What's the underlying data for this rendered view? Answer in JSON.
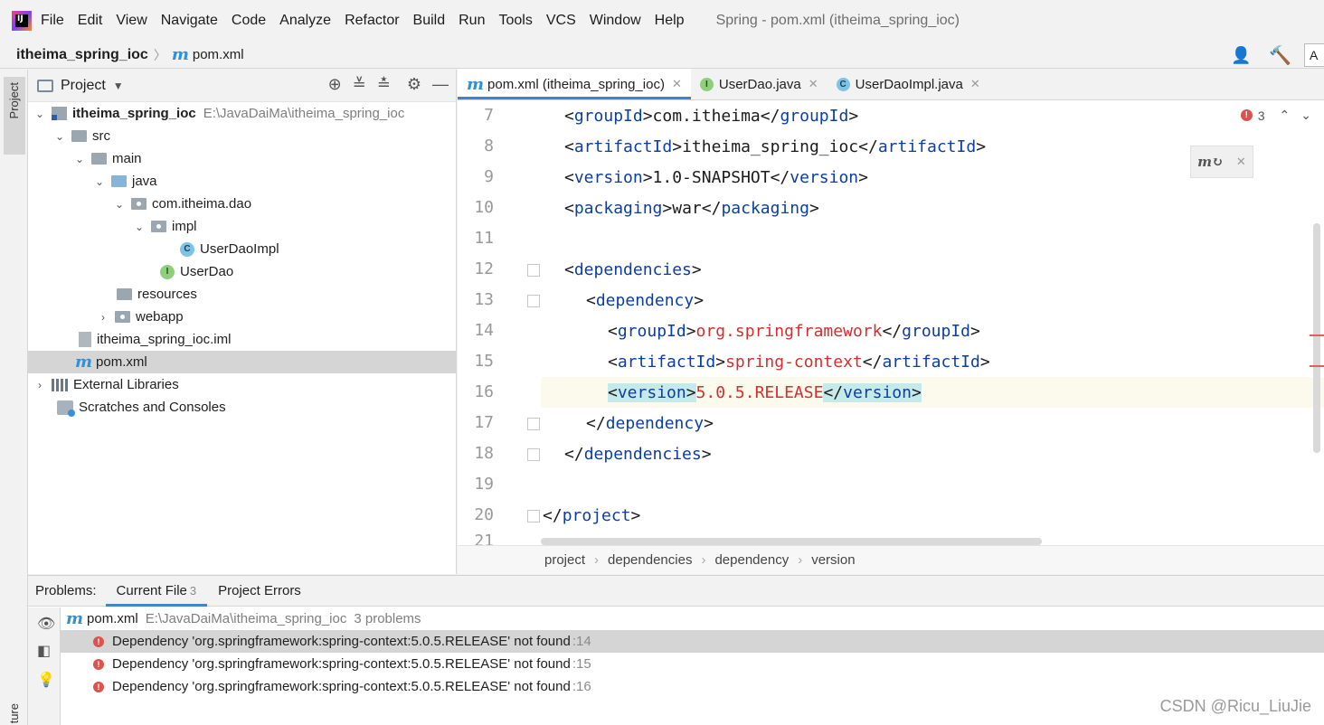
{
  "menubar": {
    "items": [
      "File",
      "Edit",
      "View",
      "Navigate",
      "Code",
      "Analyze",
      "Refactor",
      "Build",
      "Run",
      "Tools",
      "VCS",
      "Window",
      "Help"
    ],
    "window_title": "Spring - pom.xml (itheima_spring_ioc)"
  },
  "navbar": {
    "project": "itheima_spring_ioc",
    "file": "pom.xml",
    "right_button": "A"
  },
  "stripe": {
    "project_tab": "Project",
    "structure_tab": "ture"
  },
  "project_panel": {
    "title": "Project",
    "tree": [
      {
        "label": "itheima_spring_ioc",
        "path": "E:\\JavaDaiMa\\itheima_spring_ioc"
      },
      {
        "label": "src"
      },
      {
        "label": "main"
      },
      {
        "label": "java"
      },
      {
        "label": "com.itheima.dao"
      },
      {
        "label": "impl"
      },
      {
        "label": "UserDaoImpl"
      },
      {
        "label": "UserDao"
      },
      {
        "label": "resources"
      },
      {
        "label": "webapp"
      },
      {
        "label": "itheima_spring_ioc.iml"
      },
      {
        "label": "pom.xml"
      },
      {
        "label": "External Libraries"
      },
      {
        "label": "Scratches and Consoles"
      }
    ]
  },
  "editor": {
    "tabs": [
      {
        "label": "pom.xml (itheima_spring_ioc)",
        "active": true
      },
      {
        "label": "UserDao.java"
      },
      {
        "label": "UserDaoImpl.java"
      }
    ],
    "error_count": "3",
    "line_numbers": [
      "7",
      "8",
      "9",
      "10",
      "11",
      "12",
      "13",
      "14",
      "15",
      "16",
      "17",
      "18",
      "19",
      "20",
      "21"
    ],
    "code": {
      "l7_tag": "groupId",
      "l7_val": "com.itheima",
      "l8_tag": "artifactId",
      "l8_val": "itheima_spring_ioc",
      "l9_tag": "version",
      "l9_val": "1.0-SNAPSHOT",
      "l10_tag": "packaging",
      "l10_val": "war",
      "l12_tag": "dependencies",
      "l13_tag": "dependency",
      "l14_tag": "groupId",
      "l14_val": "org.springframework",
      "l15_tag": "artifactId",
      "l15_val": "spring-context",
      "l16_tag": "version",
      "l16_val": "5.0.5.RELEASE",
      "l17_tag": "dependency",
      "l18_tag": "dependencies",
      "l20_tag": "project"
    },
    "breadcrumb": [
      "project",
      "dependencies",
      "dependency",
      "version"
    ]
  },
  "problems": {
    "label": "Problems:",
    "tabs": [
      {
        "label": "Current File",
        "count": "3",
        "active": true
      },
      {
        "label": "Project Errors"
      }
    ],
    "file": "pom.xml",
    "file_path": "E:\\JavaDaiMa\\itheima_spring_ioc",
    "summary": "3 problems",
    "items": [
      {
        "message": "Dependency 'org.springframework:spring-context:5.0.5.RELEASE' not found",
        "line": ":14"
      },
      {
        "message": "Dependency 'org.springframework:spring-context:5.0.5.RELEASE' not found",
        "line": ":15"
      },
      {
        "message": "Dependency 'org.springframework:spring-context:5.0.5.RELEASE' not found",
        "line": ":16"
      }
    ]
  },
  "watermark": "CSDN @Ricu_LiuJie",
  "colors": {
    "accent": "#4083c9",
    "xml_tag": "#0c3ea3",
    "error": "#d32f2f",
    "maven_blue": "#2f8fd9"
  }
}
